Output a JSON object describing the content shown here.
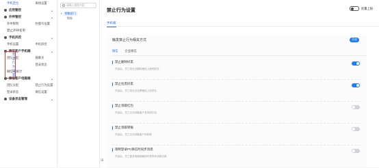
{
  "nav": {
    "rows": [
      {
        "type": "pair",
        "items": [
          "手机定位",
          "离线设置"
        ],
        "highlight": 0
      },
      {
        "type": "group",
        "label": "应用管控"
      },
      {
        "type": "group",
        "label": "外呼管控"
      },
      {
        "type": "pair",
        "items": [
          "外呼限制",
          "防骚号设置"
        ],
        "highlight": -1
      },
      {
        "type": "single",
        "label": "禁止外呼名单"
      },
      {
        "type": "group",
        "label": "手机风控"
      },
      {
        "type": "pair",
        "items": [
          "手机设置",
          "手机风控"
        ],
        "highlight": -1
      },
      {
        "type": "group",
        "label": "微信客户手机端"
      },
      {
        "type": "pair",
        "items": [
          "团队分配",
          "微聊天"
        ],
        "highlight": -1
      },
      {
        "type": "selected",
        "items": [
          "禁止行为设置",
          "登录状态"
        ]
      },
      {
        "type": "single",
        "label": "微信号统计"
      },
      {
        "type": "group",
        "label": "微信客户电脑端"
      },
      {
        "type": "pair",
        "items": [
          "团队分配",
          "禁止行为设置"
        ],
        "highlight": -1
      },
      {
        "type": "pair",
        "items": [
          "登录状态",
          "微信设置"
        ],
        "highlight": -1
      },
      {
        "type": "group",
        "label": "设备状态管理"
      }
    ]
  },
  "tree": {
    "search_placeholder": "请输入搜索内容",
    "root": "销售部门",
    "child": "财务"
  },
  "main": {
    "title": "禁止行为设置",
    "top_toggle_label": "批量上报",
    "tab": "手机端",
    "card_title": "触发禁止行为相关方式",
    "pill_label": "开启",
    "subtabs": [
      "微信",
      "企业微信"
    ],
    "rules": [
      {
        "title": "禁止删除好友",
        "desc": "开启后，员工将无法删除微信上面的好友",
        "on": true
      },
      {
        "title": "禁止拉黑好友",
        "desc": "开启后，员工将无法拉黑微信上的好友",
        "on": true
      },
      {
        "title": "禁止领取红包",
        "desc": "开启后，员工无法领取客户发来的红包",
        "on": false
      },
      {
        "title": "禁止领取转账",
        "desc": "开启后，员工无法领取客户的转账",
        "on": false
      },
      {
        "title": "限制登录PC微信时同步消息",
        "desc": "开启后，员工登录电脑端微信时将同步消息记录",
        "on": false
      }
    ]
  },
  "colors": {
    "accent": "#1f7cf2",
    "highlight_border": "#e53935"
  }
}
